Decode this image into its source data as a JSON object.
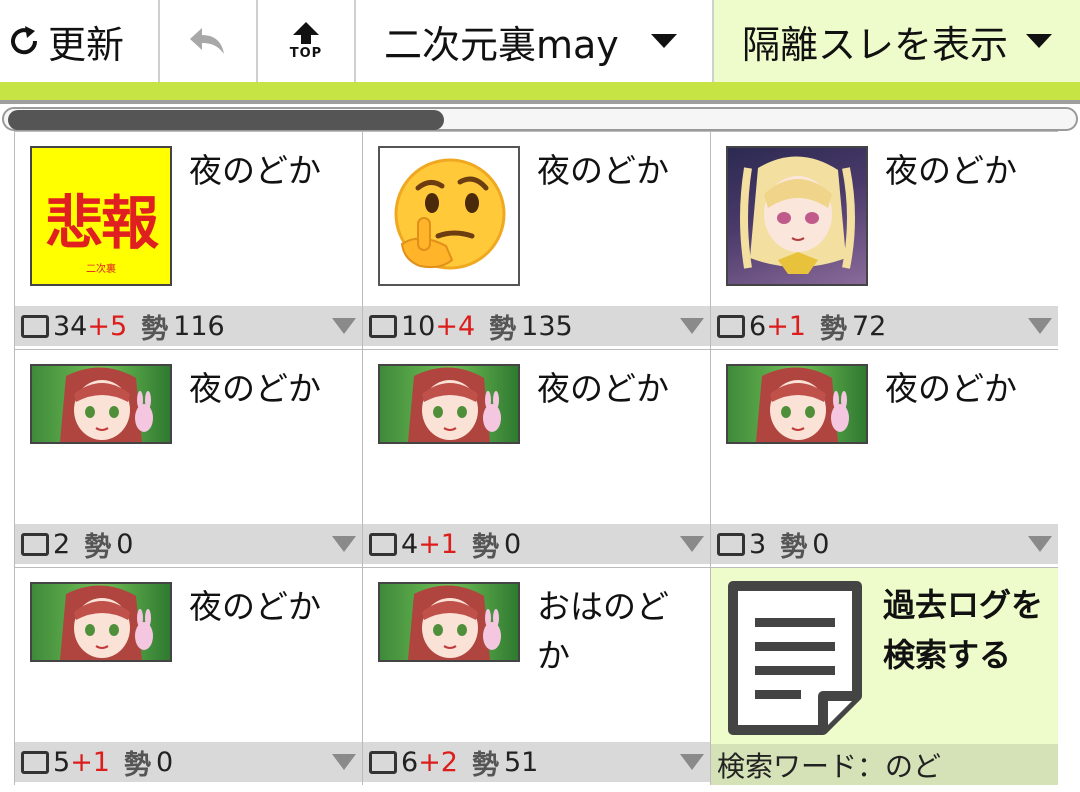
{
  "toolbar": {
    "refresh_label": "更新",
    "board_name": "二次元裏may",
    "isolated_label": "隔離スレを表示",
    "top_label": "TOP"
  },
  "threads": [
    {
      "title": "夜のどか",
      "res": "34",
      "inc": "+5",
      "ikioi_label": "勢",
      "ikioi": "116",
      "thumb": "hihou",
      "thumb_text": "悲報",
      "thumb_caption": "二次裏"
    },
    {
      "title": "夜のどか",
      "res": "10",
      "inc": "+4",
      "ikioi_label": "勢",
      "ikioi": "135",
      "thumb": "thinking-emoji"
    },
    {
      "title": "夜のどか",
      "res": "6",
      "inc": "+1",
      "ikioi_label": "勢",
      "ikioi": "72",
      "thumb": "anime-blonde"
    },
    {
      "title": "夜のどか",
      "res": "2",
      "inc": "",
      "ikioi_label": "勢",
      "ikioi": "0",
      "thumb": "anime-pink"
    },
    {
      "title": "夜のどか",
      "res": "4",
      "inc": "+1",
      "ikioi_label": "勢",
      "ikioi": "0",
      "thumb": "anime-pink"
    },
    {
      "title": "夜のどか",
      "res": "3",
      "inc": "",
      "ikioi_label": "勢",
      "ikioi": "0",
      "thumb": "anime-pink"
    },
    {
      "title": "夜のどか",
      "res": "5",
      "inc": "+1",
      "ikioi_label": "勢",
      "ikioi": "0",
      "thumb": "anime-pink"
    },
    {
      "title": "おはのどか",
      "res": "6",
      "inc": "+2",
      "ikioi_label": "勢",
      "ikioi": "51",
      "thumb": "anime-pink"
    }
  ],
  "search": {
    "title": "過去ログを検索する",
    "keyword": "検索ワード：のど",
    "icon": "document-icon"
  },
  "colors": {
    "accent_lime": "#c6e544",
    "pale_green": "#eefccb",
    "increment_red": "#dd1c1c"
  }
}
